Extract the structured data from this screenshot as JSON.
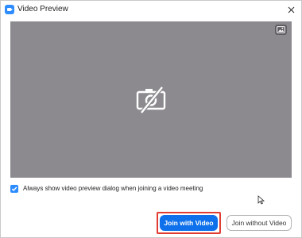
{
  "window": {
    "title": "Video Preview"
  },
  "preview": {
    "state": "camera-off",
    "background_color": "#8c8a8f",
    "icons": {
      "camera_off": "video-camera-off-icon",
      "virtual_background": "virtual-background-icon"
    }
  },
  "options": {
    "always_show_preview": {
      "label": "Always show video preview dialog when joining a video meeting",
      "checked": true
    }
  },
  "buttons": {
    "join_with_video": "Join with Video",
    "join_without_video": "Join without Video"
  },
  "colors": {
    "accent": "#2d8cff",
    "primary_button": "#0e71eb",
    "focus_ring": "#e03c31"
  }
}
